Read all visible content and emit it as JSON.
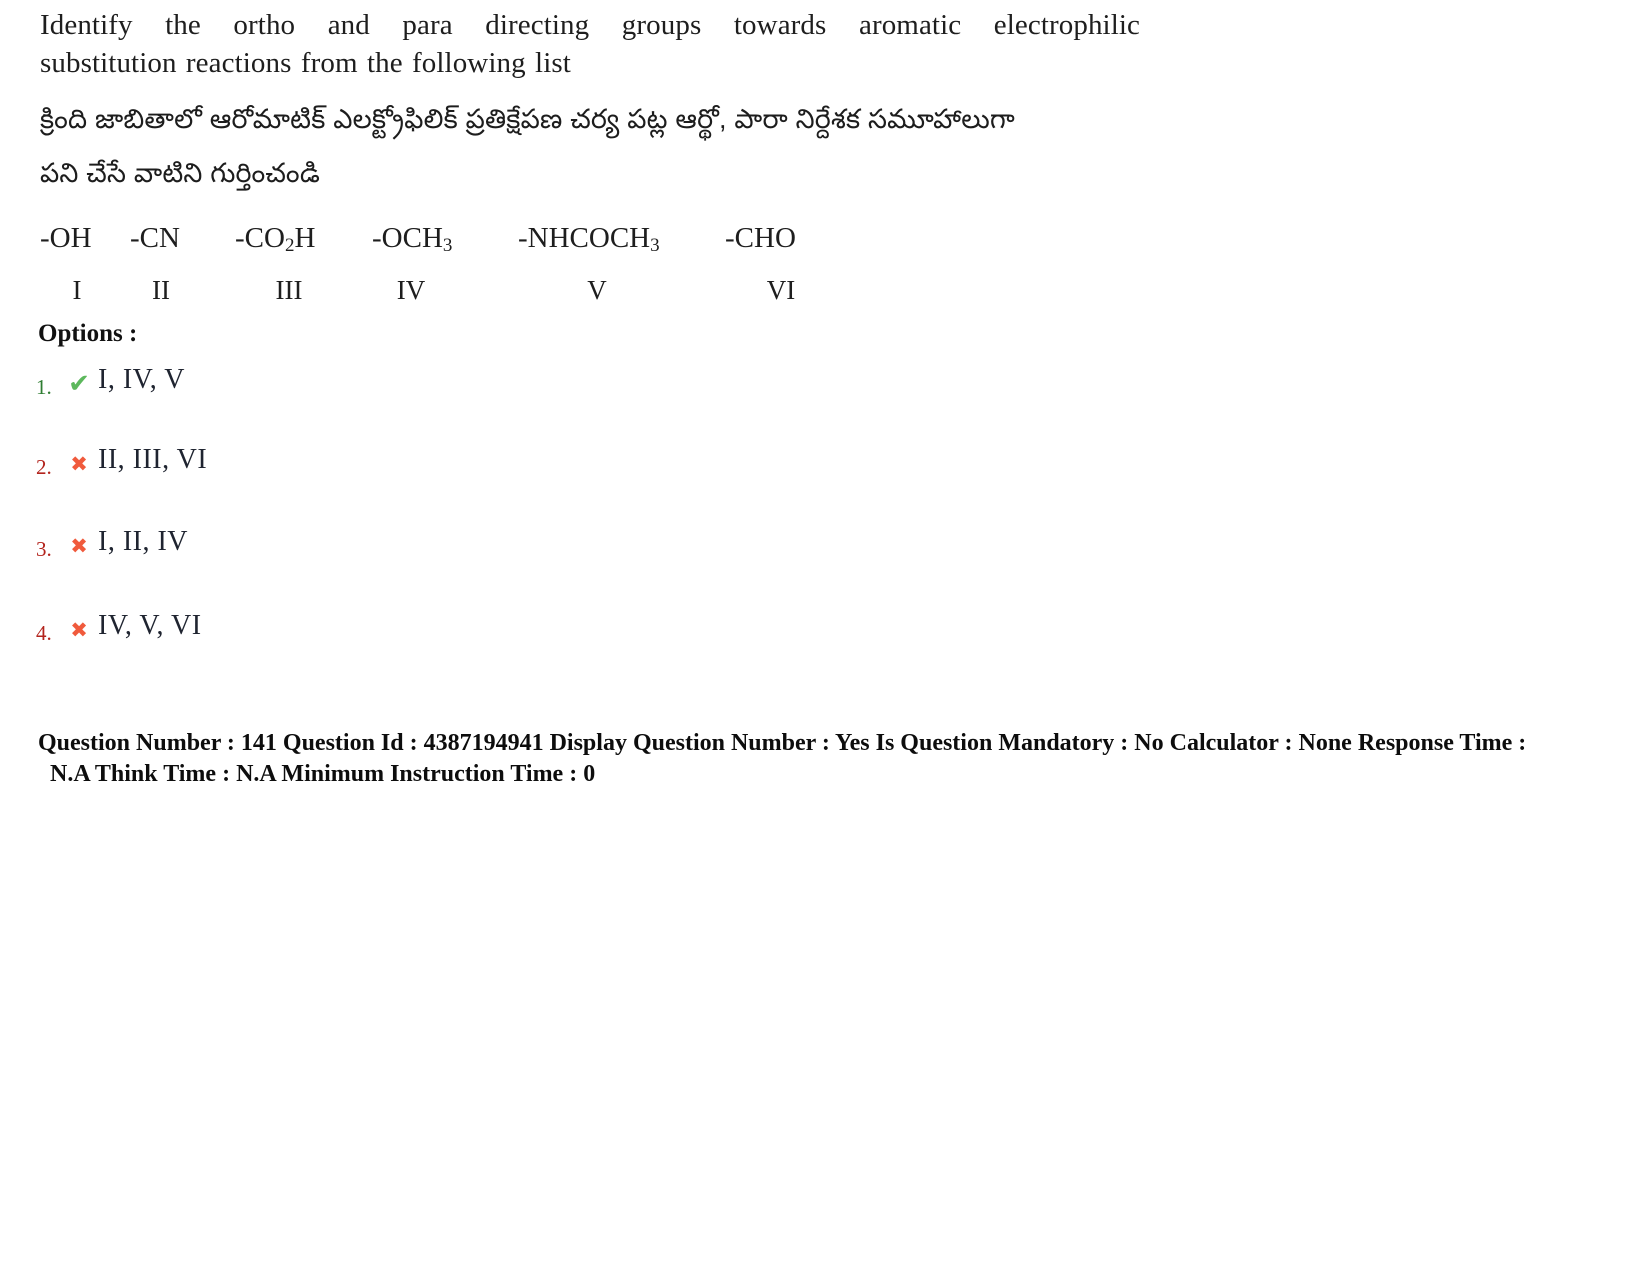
{
  "question": {
    "stem_lines": [
      "Identify the ortho and para directing groups towards aromatic electrophilic",
      "substitution reactions from the following list"
    ],
    "telugu_lines": [
      "క్రింది జాబితాలో  ఆరోమాటిక్ ఎలక్ట్రోఫిలిక్ ప్రతిక్షేపణ చర్య పట్ల ఆర్థో, పారా  నిర్దేశక సమూహాలుగా",
      "పని చేసే వాటిని గుర్తించండి"
    ],
    "groups": [
      {
        "formula": "-OH",
        "numeral": "I"
      },
      {
        "formula": "-CN",
        "numeral": "II"
      },
      {
        "formula": "-CO2H",
        "numeral": "III"
      },
      {
        "formula": "-OCH3",
        "numeral": "IV"
      },
      {
        "formula": "-NHCOCH3",
        "numeral": "V"
      },
      {
        "formula": "-CHO",
        "numeral": "VI"
      }
    ]
  },
  "options": {
    "label": "Options :",
    "items": [
      {
        "number": "1.",
        "text": "I, IV, V",
        "mark": "check-icon",
        "glyph": "✔",
        "state": "correct"
      },
      {
        "number": "2.",
        "text": "II, III, VI",
        "mark": "cross-icon",
        "glyph": "✖",
        "state": "wrong"
      },
      {
        "number": "3.",
        "text": "I, II, IV",
        "mark": "cross-icon",
        "glyph": "✖",
        "state": "wrong"
      },
      {
        "number": "4.",
        "text": "IV, V, VI",
        "mark": "cross-icon",
        "glyph": "✖",
        "state": "wrong"
      }
    ]
  },
  "metadata": {
    "line1": "Question Number : 141 Question Id : 4387194941 Display Question Number : Yes Is Question Mandatory : No Calculator : None Response Time :",
    "line2": "N.A Think Time : N.A Minimum Instruction Time : 0"
  },
  "colors": {
    "correct_green": "#5cb85c",
    "correct_num_green": "#2f7d32",
    "wrong_orange": "#f05a3c",
    "wrong_num_red": "#b3231c",
    "body_text": "#1e1e1e"
  }
}
